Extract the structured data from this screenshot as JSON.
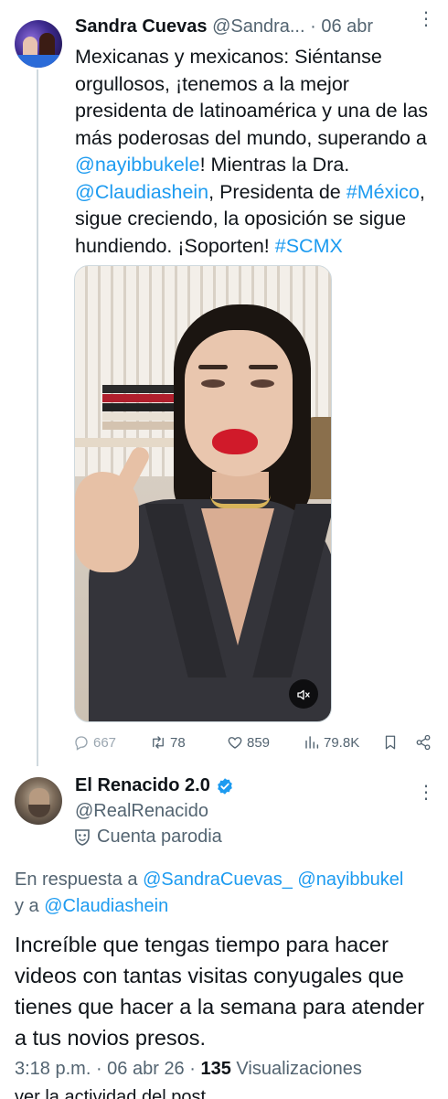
{
  "tweet": {
    "author_name": "Sandra Cuevas",
    "author_handle": "@Sandra...",
    "date": "06 abr",
    "text_before_mention1": "Mexicanas y mexicanos: Siéntanse orgullosos, ¡tenemos a la mejor presidenta de latinoamérica y una de las más poderosas del mundo, superando a ",
    "mention1": "@nayibbukele",
    "text_after_mention1": "! Mientras la Dra. ",
    "mention2": "@Claudiashein",
    "text_after_mention2": ", Presidenta de ",
    "hashtag1": "#México",
    "text_after_hashtag1": ", sigue creciendo, la oposición se sigue hundiendo. ¡Soporten! ",
    "hashtag2": "#SCMX",
    "actions": {
      "replies": "667",
      "retweets": "78",
      "likes": "859",
      "views": "79.8K"
    }
  },
  "reply": {
    "author_name": "El Renacido 2.0",
    "author_handle": "@RealRenacido",
    "parody_label": "Cuenta parodia",
    "replying_prefix": "En respuesta a ",
    "replying_user1": "@SandraCuevas_",
    "replying_user2": "@nayibbukel",
    "replying_and": "y a ",
    "replying_user3": "@Claudiashein",
    "text": "Increíble que tengas tiempo para hacer videos con tantas visitas conyugales que tienes que hacer a la semana para atender a tus novios presos.",
    "time": "3:18 p.m.",
    "date": "06 abr 26",
    "views_count": "135",
    "views_label": "Visualizaciones",
    "cut_off_text": "ver la actividad del post"
  },
  "icons": {
    "reply": "reply-icon",
    "retweet": "retweet-icon",
    "like": "heart-icon",
    "views": "views-icon",
    "bookmark": "bookmark-icon",
    "share": "share-icon",
    "verified": "verified-badge-icon",
    "mute": "mute-icon",
    "parody": "parody-mask-icon",
    "more": "more-icon"
  },
  "colors": {
    "link": "#1d9bf0",
    "secondary_text": "#536471",
    "verified": "#1d9bf0"
  }
}
